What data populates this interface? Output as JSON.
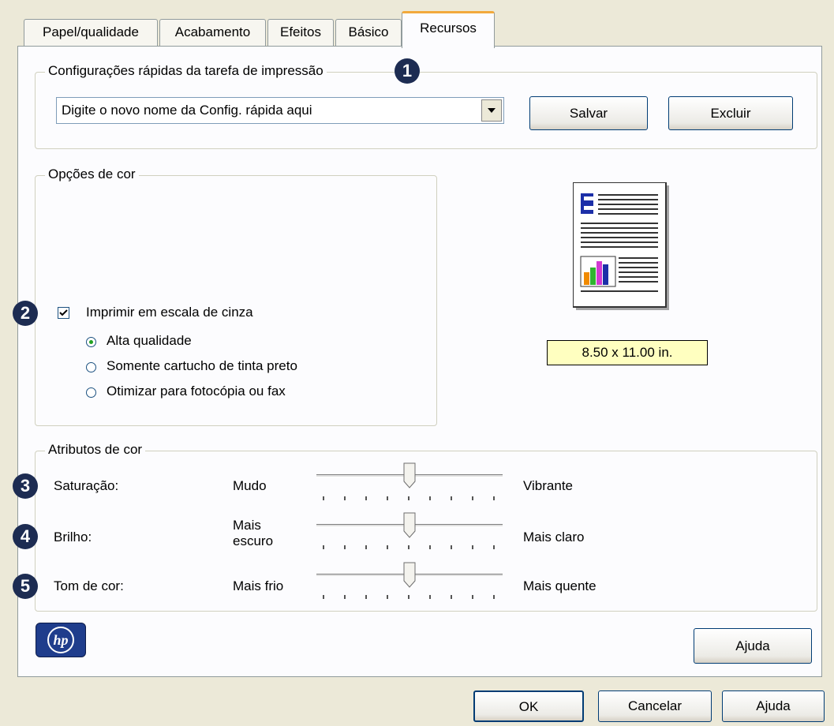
{
  "tabs": [
    {
      "label": "Papel/qualidade"
    },
    {
      "label": "Acabamento"
    },
    {
      "label": "Efeitos"
    },
    {
      "label": "Básico"
    },
    {
      "label": "Recursos"
    }
  ],
  "quick_settings": {
    "title": "Configurações rápidas da tarefa de impressão",
    "badge": "1",
    "combo_value": "Digite o novo nome da Config. rápida aqui",
    "save_label": "Salvar",
    "delete_label": "Excluir"
  },
  "color_options": {
    "title": "Opções de cor",
    "badge": "2",
    "grayscale_label": "Imprimir em escala de cinza",
    "grayscale_checked": true,
    "radios": [
      {
        "label": "Alta qualidade",
        "selected": true
      },
      {
        "label": "Somente cartucho de tinta preto",
        "selected": false
      },
      {
        "label": "Otimizar para fotocópia ou fax",
        "selected": false
      }
    ]
  },
  "preview": {
    "size_label": "8.50 x 11.00 in."
  },
  "color_attributes": {
    "title": "Atributos de cor",
    "sliders": [
      {
        "badge": "3",
        "label": "Saturação:",
        "min_label": "Mudo",
        "max_label": "Vibrante",
        "position": 0.5
      },
      {
        "badge": "4",
        "label": "Brilho:",
        "min_label": "Mais escuro",
        "max_label": "Mais claro",
        "position": 0.5
      },
      {
        "badge": "5",
        "label": "Tom de cor:",
        "min_label": "Mais frio",
        "max_label": "Mais quente",
        "position": 0.5
      }
    ]
  },
  "logo": {
    "text": "hp"
  },
  "panel_help_label": "Ajuda",
  "footer": {
    "ok_label": "OK",
    "cancel_label": "Cancelar",
    "help_label": "Ajuda"
  },
  "colors": {
    "window_bg": "#ece9d8",
    "panel_bg": "#fcfcfe",
    "tab_highlight": "#f2a93c",
    "badge_bg": "#1d2c52",
    "size_label_bg": "#ffffc0"
  }
}
